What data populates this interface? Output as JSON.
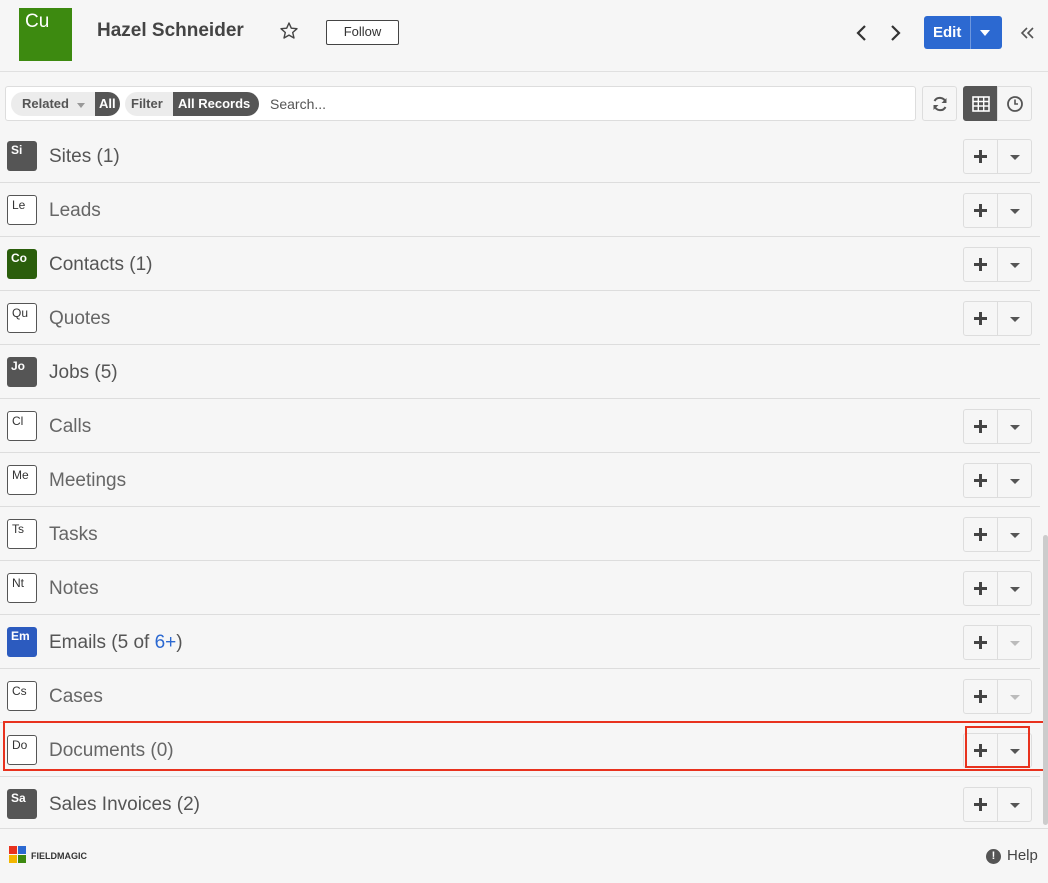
{
  "header": {
    "record_icon": "Cu",
    "record_icon_color": "#3d8a10",
    "record_name": "Hazel Schneider",
    "follow_label": "Follow",
    "edit_label": "Edit",
    "accent_color": "#2c69d1"
  },
  "filters": {
    "related_label": "Related",
    "related_value": "All",
    "filter_label": "Filter",
    "filter_value": "All Records",
    "search_placeholder": "Search..."
  },
  "rows": [
    {
      "badge": "Si",
      "badge_style": "filled",
      "badge_color": "#555555",
      "label": "Sites (1)",
      "count_link": "",
      "suffix": "",
      "actions": true,
      "more_enabled": true
    },
    {
      "badge": "Le",
      "badge_style": "outline",
      "badge_color": "#ffffff",
      "label": "Leads",
      "count_link": "",
      "suffix": "",
      "actions": true,
      "more_enabled": true
    },
    {
      "badge": "Co",
      "badge_style": "filled",
      "badge_color": "#2b5e0c",
      "label": "Contacts (1)",
      "count_link": "",
      "suffix": "",
      "actions": true,
      "more_enabled": true
    },
    {
      "badge": "Qu",
      "badge_style": "outline",
      "badge_color": "#ffffff",
      "label": "Quotes",
      "count_link": "",
      "suffix": "",
      "actions": true,
      "more_enabled": true
    },
    {
      "badge": "Jo",
      "badge_style": "filled",
      "badge_color": "#555555",
      "label": "Jobs (5)",
      "count_link": "",
      "suffix": "",
      "actions": false,
      "more_enabled": false
    },
    {
      "badge": "Cl",
      "badge_style": "outline",
      "badge_color": "#ffffff",
      "label": "Calls",
      "count_link": "",
      "suffix": "",
      "actions": true,
      "more_enabled": true
    },
    {
      "badge": "Me",
      "badge_style": "outline",
      "badge_color": "#ffffff",
      "label": "Meetings",
      "count_link": "",
      "suffix": "",
      "actions": true,
      "more_enabled": true
    },
    {
      "badge": "Ts",
      "badge_style": "outline",
      "badge_color": "#ffffff",
      "label": "Tasks",
      "count_link": "",
      "suffix": "",
      "actions": true,
      "more_enabled": true
    },
    {
      "badge": "Nt",
      "badge_style": "outline",
      "badge_color": "#ffffff",
      "label": "Notes",
      "count_link": "",
      "suffix": "",
      "actions": true,
      "more_enabled": true
    },
    {
      "badge": "Em",
      "badge_style": "filled",
      "badge_color": "#2c5bbf",
      "label": "Emails (5 of ",
      "count_link": "6+",
      "suffix": ")",
      "actions": true,
      "more_enabled": false
    },
    {
      "badge": "Cs",
      "badge_style": "outline",
      "badge_color": "#ffffff",
      "label": "Cases",
      "count_link": "",
      "suffix": "",
      "actions": true,
      "more_enabled": false
    },
    {
      "badge": "Do",
      "badge_style": "outline",
      "badge_color": "#ffffff",
      "label": "Documents (0)",
      "count_link": "",
      "suffix": "",
      "actions": true,
      "more_enabled": true
    },
    {
      "badge": "Sa",
      "badge_style": "filled",
      "badge_color": "#555555",
      "label": "Sales Invoices (2)",
      "count_link": "",
      "suffix": "",
      "actions": true,
      "more_enabled": true
    }
  ],
  "footer": {
    "brand": "FIELDMAGIC",
    "help_label": "Help"
  },
  "icons": {
    "star": "star-icon",
    "prev": "chevron-left-icon",
    "next": "chevron-right-icon",
    "collapse": "double-chevron-left-icon",
    "refresh": "refresh-icon",
    "grid": "grid-view-icon",
    "clock": "history-clock-icon"
  }
}
